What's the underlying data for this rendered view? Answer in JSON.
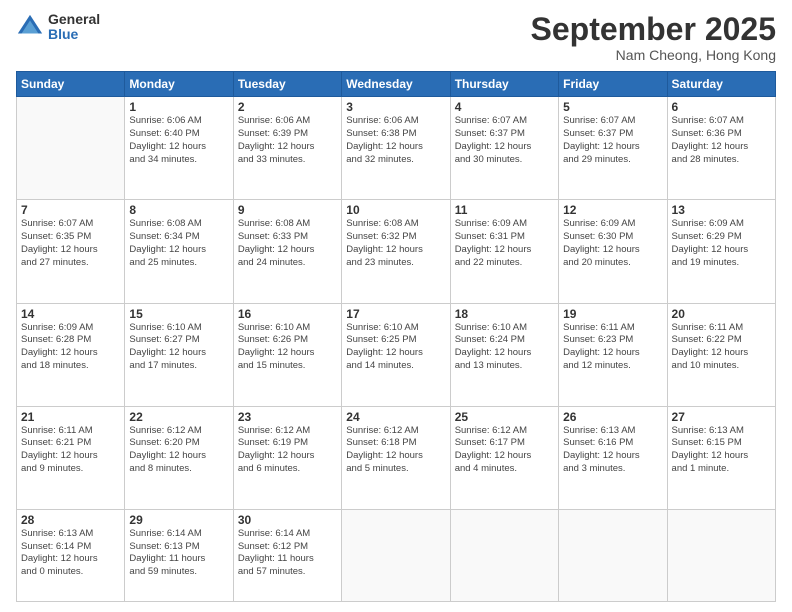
{
  "logo": {
    "general": "General",
    "blue": "Blue"
  },
  "header": {
    "month": "September 2025",
    "location": "Nam Cheong, Hong Kong"
  },
  "days_of_week": [
    "Sunday",
    "Monday",
    "Tuesday",
    "Wednesday",
    "Thursday",
    "Friday",
    "Saturday"
  ],
  "weeks": [
    [
      {
        "day": "",
        "info": ""
      },
      {
        "day": "1",
        "info": "Sunrise: 6:06 AM\nSunset: 6:40 PM\nDaylight: 12 hours\nand 34 minutes."
      },
      {
        "day": "2",
        "info": "Sunrise: 6:06 AM\nSunset: 6:39 PM\nDaylight: 12 hours\nand 33 minutes."
      },
      {
        "day": "3",
        "info": "Sunrise: 6:06 AM\nSunset: 6:38 PM\nDaylight: 12 hours\nand 32 minutes."
      },
      {
        "day": "4",
        "info": "Sunrise: 6:07 AM\nSunset: 6:37 PM\nDaylight: 12 hours\nand 30 minutes."
      },
      {
        "day": "5",
        "info": "Sunrise: 6:07 AM\nSunset: 6:37 PM\nDaylight: 12 hours\nand 29 minutes."
      },
      {
        "day": "6",
        "info": "Sunrise: 6:07 AM\nSunset: 6:36 PM\nDaylight: 12 hours\nand 28 minutes."
      }
    ],
    [
      {
        "day": "7",
        "info": "Sunrise: 6:07 AM\nSunset: 6:35 PM\nDaylight: 12 hours\nand 27 minutes."
      },
      {
        "day": "8",
        "info": "Sunrise: 6:08 AM\nSunset: 6:34 PM\nDaylight: 12 hours\nand 25 minutes."
      },
      {
        "day": "9",
        "info": "Sunrise: 6:08 AM\nSunset: 6:33 PM\nDaylight: 12 hours\nand 24 minutes."
      },
      {
        "day": "10",
        "info": "Sunrise: 6:08 AM\nSunset: 6:32 PM\nDaylight: 12 hours\nand 23 minutes."
      },
      {
        "day": "11",
        "info": "Sunrise: 6:09 AM\nSunset: 6:31 PM\nDaylight: 12 hours\nand 22 minutes."
      },
      {
        "day": "12",
        "info": "Sunrise: 6:09 AM\nSunset: 6:30 PM\nDaylight: 12 hours\nand 20 minutes."
      },
      {
        "day": "13",
        "info": "Sunrise: 6:09 AM\nSunset: 6:29 PM\nDaylight: 12 hours\nand 19 minutes."
      }
    ],
    [
      {
        "day": "14",
        "info": "Sunrise: 6:09 AM\nSunset: 6:28 PM\nDaylight: 12 hours\nand 18 minutes."
      },
      {
        "day": "15",
        "info": "Sunrise: 6:10 AM\nSunset: 6:27 PM\nDaylight: 12 hours\nand 17 minutes."
      },
      {
        "day": "16",
        "info": "Sunrise: 6:10 AM\nSunset: 6:26 PM\nDaylight: 12 hours\nand 15 minutes."
      },
      {
        "day": "17",
        "info": "Sunrise: 6:10 AM\nSunset: 6:25 PM\nDaylight: 12 hours\nand 14 minutes."
      },
      {
        "day": "18",
        "info": "Sunrise: 6:10 AM\nSunset: 6:24 PM\nDaylight: 12 hours\nand 13 minutes."
      },
      {
        "day": "19",
        "info": "Sunrise: 6:11 AM\nSunset: 6:23 PM\nDaylight: 12 hours\nand 12 minutes."
      },
      {
        "day": "20",
        "info": "Sunrise: 6:11 AM\nSunset: 6:22 PM\nDaylight: 12 hours\nand 10 minutes."
      }
    ],
    [
      {
        "day": "21",
        "info": "Sunrise: 6:11 AM\nSunset: 6:21 PM\nDaylight: 12 hours\nand 9 minutes."
      },
      {
        "day": "22",
        "info": "Sunrise: 6:12 AM\nSunset: 6:20 PM\nDaylight: 12 hours\nand 8 minutes."
      },
      {
        "day": "23",
        "info": "Sunrise: 6:12 AM\nSunset: 6:19 PM\nDaylight: 12 hours\nand 6 minutes."
      },
      {
        "day": "24",
        "info": "Sunrise: 6:12 AM\nSunset: 6:18 PM\nDaylight: 12 hours\nand 5 minutes."
      },
      {
        "day": "25",
        "info": "Sunrise: 6:12 AM\nSunset: 6:17 PM\nDaylight: 12 hours\nand 4 minutes."
      },
      {
        "day": "26",
        "info": "Sunrise: 6:13 AM\nSunset: 6:16 PM\nDaylight: 12 hours\nand 3 minutes."
      },
      {
        "day": "27",
        "info": "Sunrise: 6:13 AM\nSunset: 6:15 PM\nDaylight: 12 hours\nand 1 minute."
      }
    ],
    [
      {
        "day": "28",
        "info": "Sunrise: 6:13 AM\nSunset: 6:14 PM\nDaylight: 12 hours\nand 0 minutes."
      },
      {
        "day": "29",
        "info": "Sunrise: 6:14 AM\nSunset: 6:13 PM\nDaylight: 11 hours\nand 59 minutes."
      },
      {
        "day": "30",
        "info": "Sunrise: 6:14 AM\nSunset: 6:12 PM\nDaylight: 11 hours\nand 57 minutes."
      },
      {
        "day": "",
        "info": ""
      },
      {
        "day": "",
        "info": ""
      },
      {
        "day": "",
        "info": ""
      },
      {
        "day": "",
        "info": ""
      }
    ]
  ]
}
